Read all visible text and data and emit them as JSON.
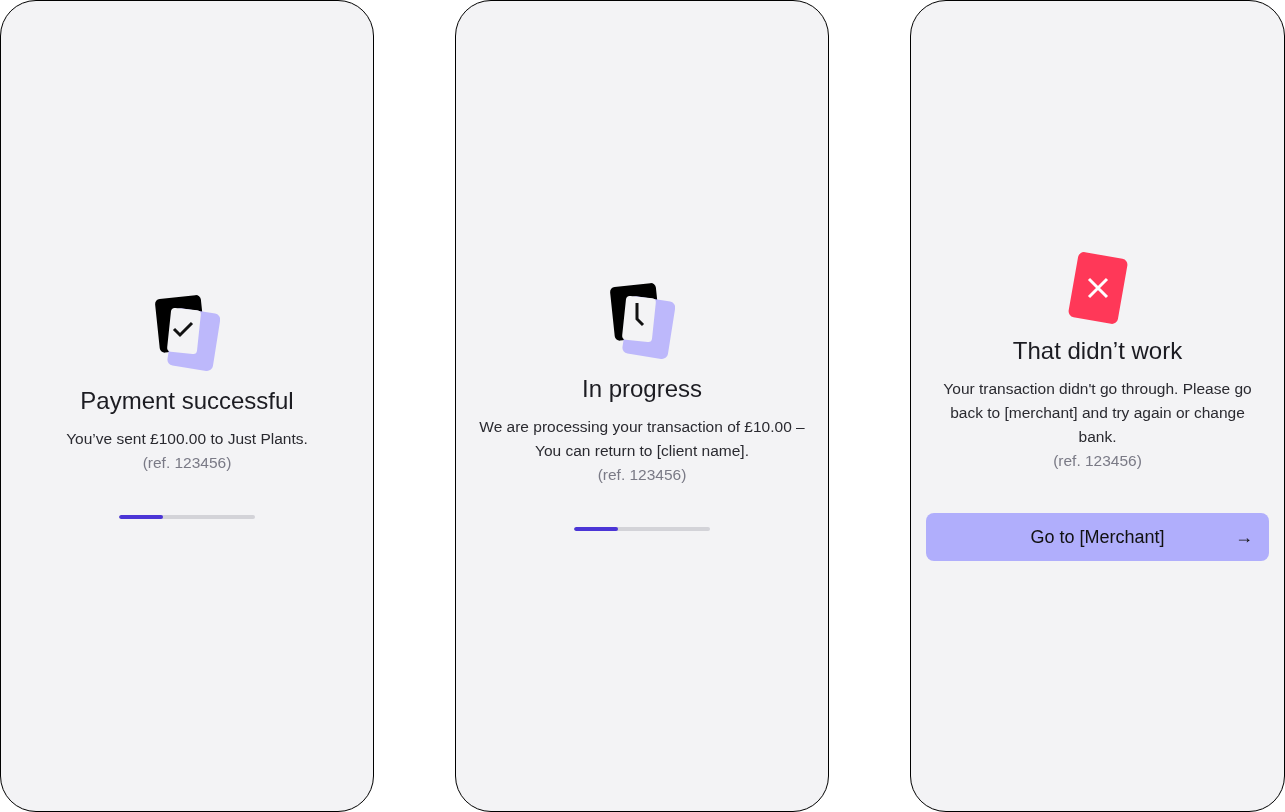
{
  "screens": [
    {
      "kind": "success",
      "title": "Payment successful",
      "message": "You’ve sent £100.00 to Just Plants.",
      "reference": "(ref. 123456)",
      "progress": {
        "level": 0.32
      }
    },
    {
      "kind": "pending",
      "title": "In progress",
      "message": "We are processing your transaction of £10.00 – You can return to [client name].",
      "reference": "(ref. 123456)",
      "progress": {
        "level": 0.32
      }
    },
    {
      "kind": "error",
      "title": "That didn’t work",
      "message": "Your transaction didn't go through. Please go back to [merchant] and try again or change bank.",
      "reference": "(ref. 123456)",
      "button": {
        "label": "Go to [Merchant]",
        "icon": "→"
      }
    }
  ]
}
